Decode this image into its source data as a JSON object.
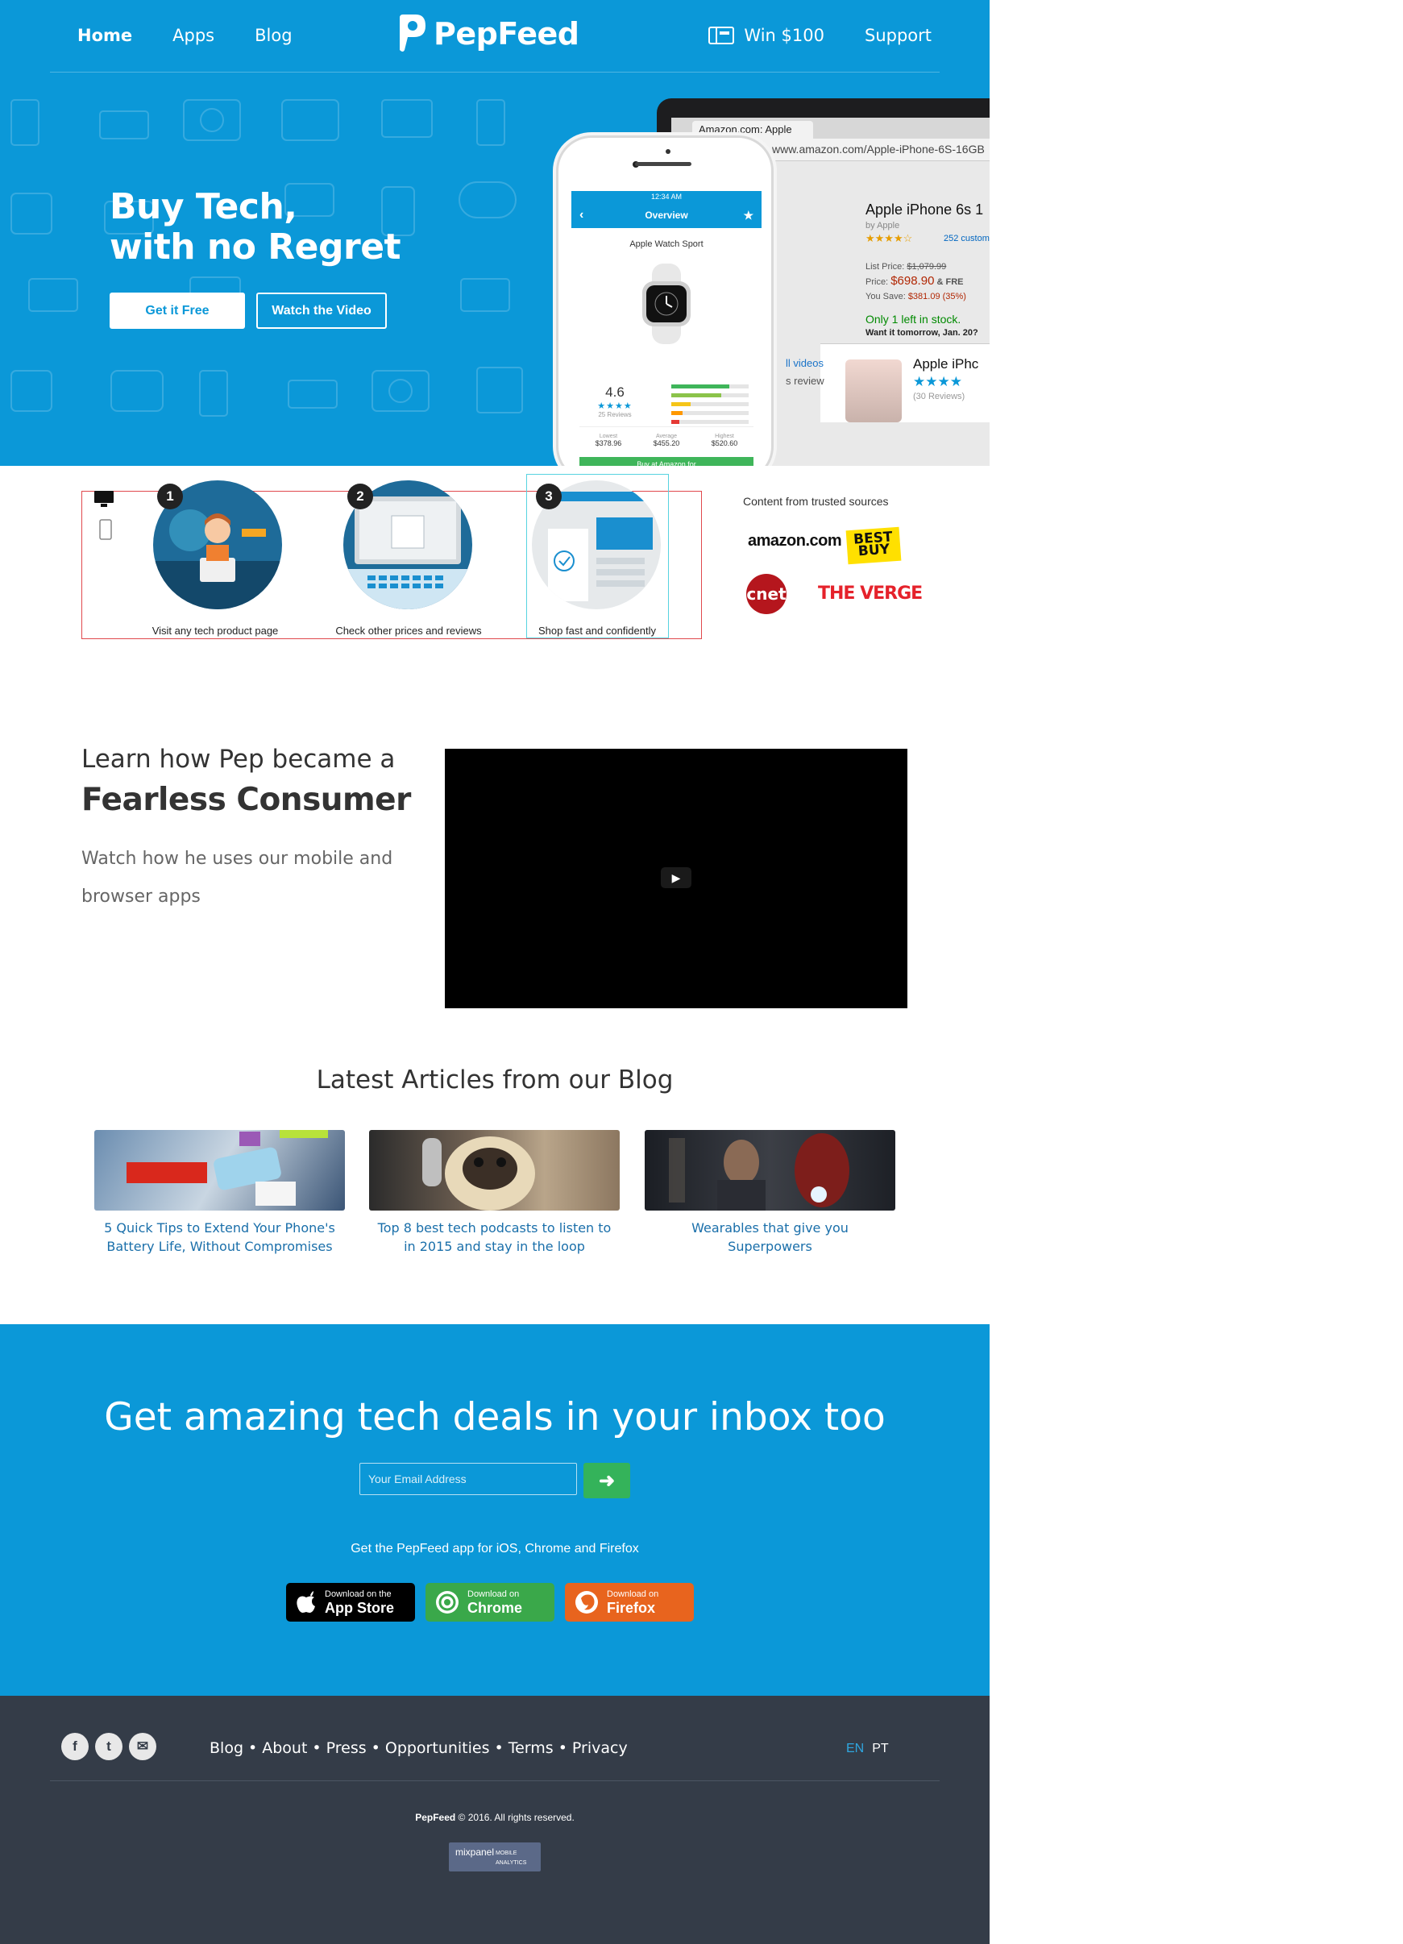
{
  "nav": {
    "home": "Home",
    "apps": "Apps",
    "blog": "Blog",
    "brand": "PepFeed",
    "win": "Win $100",
    "support": "Support"
  },
  "hero": {
    "title_line1": "Buy Tech,",
    "title_line2": "with no Regret",
    "cta_primary": "Get it Free",
    "cta_secondary": "Watch the Video"
  },
  "browser_mock": {
    "tab_title": "Amazon.com: Apple",
    "url": "www.amazon.com/Apple-iPhone-6S-16GB",
    "product_title": "Apple iPhone 6s 1",
    "by": "by Apple",
    "stars": "★★★★☆",
    "reviews": "252 custom",
    "list_price_label": "List Price:",
    "list_price": "$1,079.99",
    "price_label": "Price:",
    "price": "$698.90",
    "price_suffix": "& FRE",
    "save_label": "You Save:",
    "save": "$381.09 (35%)",
    "stock": "Only 1 left in stock.",
    "tomorrow": "Want it tomorrow, Jan. 20?",
    "panel_left1": "ll videos",
    "panel_left2": "s review",
    "panel_title": "Apple iPhc",
    "panel_stars": "★★★★",
    "panel_count": "(30 Reviews)"
  },
  "phone_mock": {
    "status": "12:34 AM",
    "header": "Overview",
    "product": "Apple Watch Sport",
    "rating": "4.6",
    "stars": "★★★★",
    "reviews": "25 Reviews",
    "lowest_label": "Lowest",
    "lowest": "$378.96",
    "average_label": "Average",
    "average": "$455.20",
    "highest_label": "Highest",
    "highest": "$520.60",
    "buy": "Buy at Amazon for"
  },
  "how": {
    "steps": [
      {
        "num": "1",
        "label": "Visit any tech product page"
      },
      {
        "num": "2",
        "label": "Check other prices and reviews"
      },
      {
        "num": "3",
        "label": "Shop fast and confidently"
      }
    ],
    "trusted": "Content from trusted sources",
    "logos": {
      "amazon": "amazon.com",
      "bestbuy_line1": "BEST",
      "bestbuy_line2": "BUY",
      "cnet": "cnet",
      "verge": "THE VERGE"
    }
  },
  "video": {
    "sub": "Learn how Pep became a",
    "title": "Fearless Consumer",
    "desc": "Watch how he uses our mobile and browser apps",
    "play": "▶"
  },
  "blog": {
    "title": "Latest Articles from our Blog",
    "articles": [
      {
        "line1": "5 Quick Tips to Extend Your Phone's",
        "line2": "Battery Life, Without Compromises"
      },
      {
        "line1": "Top 8 best tech podcasts to listen to",
        "line2": "in 2015 and stay in the loop"
      },
      {
        "line1": "Wearables that give you",
        "line2": "Superpowers"
      }
    ]
  },
  "newsletter": {
    "title": "Get amazing tech deals in your inbox too",
    "placeholder": "Your Email Address",
    "submit": "➜",
    "apps_text": "Get the PepFeed app for iOS, Chrome and Firefox",
    "stores": [
      {
        "t1": "Download on the",
        "t2": "App Store",
        "color": "#000000",
        "icon": ""
      },
      {
        "t1": "Download on",
        "t2": "Chrome",
        "color": "#3aa84a",
        "icon": "◉"
      },
      {
        "t1": "Download on",
        "t2": "Firefox",
        "color": "#e8641e",
        "icon": "ff"
      }
    ]
  },
  "footer": {
    "social": [
      "f",
      "t",
      "✉"
    ],
    "links": [
      "Blog",
      "About",
      "Press",
      "Opportunities",
      "Terms",
      "Privacy"
    ],
    "sep": "•",
    "lang_en": "EN",
    "lang_pt": "PT",
    "copy_brand": "PepFeed",
    "copy_rest": "© 2016. All rights reserved.",
    "mixpanel": "mixpanel",
    "mixpanel_sub": "MOBILE ANALYTICS"
  },
  "colors": {
    "brand_blue": "#0b98d8",
    "green": "#34b35a",
    "footer": "#343c48"
  }
}
